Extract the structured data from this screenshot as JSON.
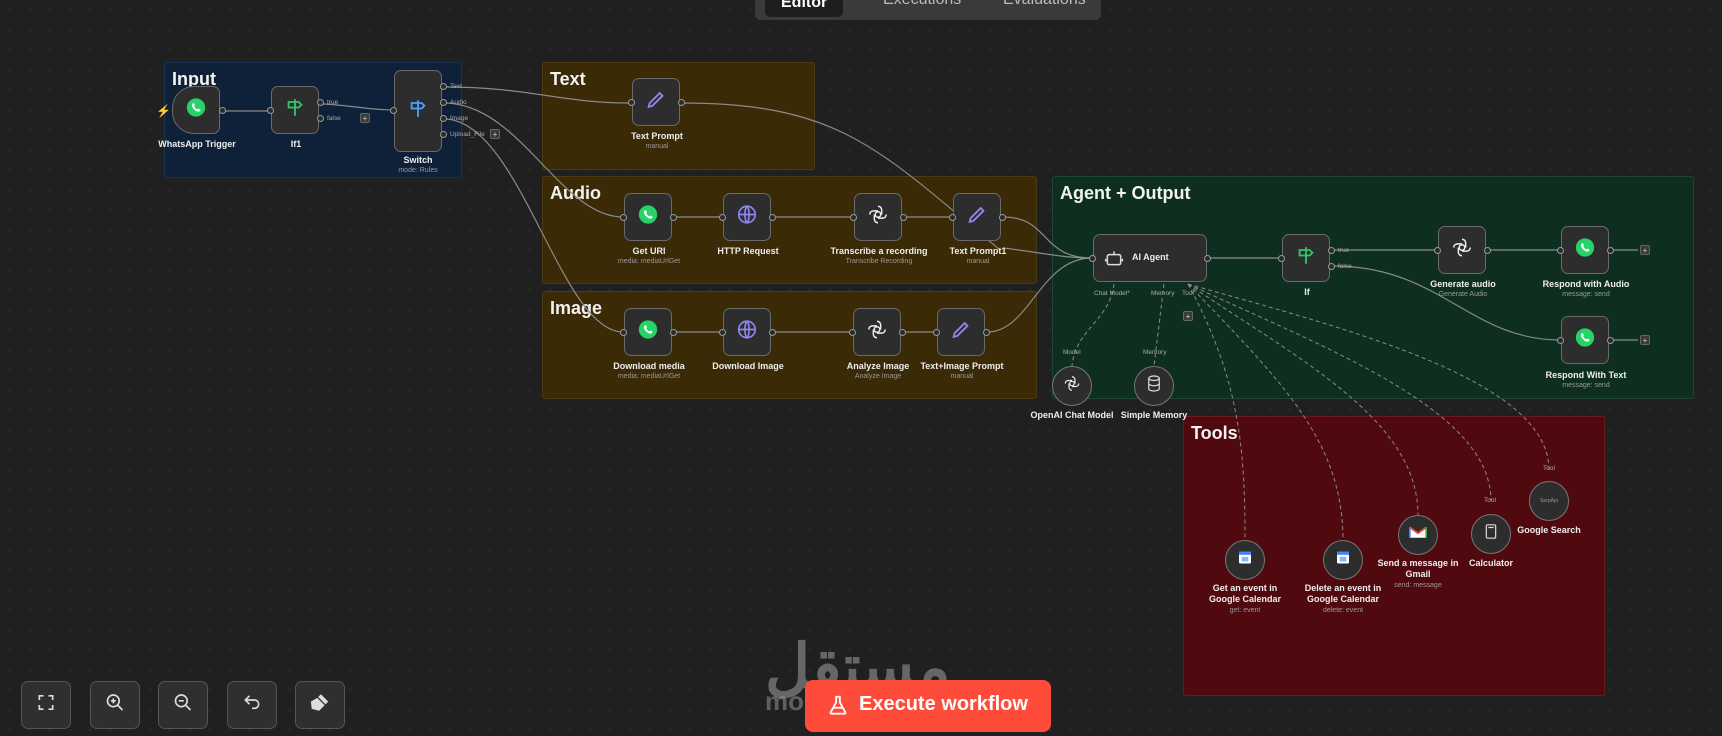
{
  "tabs": [
    "Editor",
    "Executions",
    "Evaluations"
  ],
  "sticky_notes": {
    "input": "Input",
    "text": "Text",
    "audio": "Audio",
    "image": "Image",
    "agent": "Agent + Output",
    "tools": "Tools"
  },
  "nodes": {
    "whatsapp_trigger": {
      "name": "WhatsApp Trigger"
    },
    "if1": {
      "name": "If1",
      "out_true": "true",
      "out_false": "false"
    },
    "switch": {
      "name": "Switch",
      "subtitle": "mode: Rules",
      "out_text": "Text",
      "out_audio": "Audio",
      "out_image": "Image",
      "out_upload": "Upload_File"
    },
    "text_prompt": {
      "name": "Text Prompt",
      "subtitle": "manual"
    },
    "get_url": {
      "name": "Get URl",
      "subtitle": "media: mediaUrlGet"
    },
    "http_request": {
      "name": "HTTP Request"
    },
    "transcribe": {
      "name": "Transcribe a recording",
      "subtitle": "Transcribe Recording"
    },
    "text_prompt1": {
      "name": "Text Prompt1",
      "subtitle": "manual"
    },
    "download_media": {
      "name": "Download media",
      "subtitle": "media: mediaUrlGet"
    },
    "download_image": {
      "name": "Download Image"
    },
    "analyze_image": {
      "name": "Analyze Image",
      "subtitle": "Analyze Image"
    },
    "text_image_prompt": {
      "name": "Text+Image Prompt",
      "subtitle": "manual"
    },
    "ai_agent": {
      "name": "AI Agent",
      "port_chat": "Chat Model*",
      "port_memory": "Memory",
      "port_tool": "Tool"
    },
    "if": {
      "name": "If",
      "out_true": "true",
      "out_false": "false"
    },
    "generate_audio": {
      "name": "Generate audio",
      "subtitle": "Generate Audio"
    },
    "respond_audio": {
      "name": "Respond with Audio",
      "subtitle": "message: send"
    },
    "respond_text": {
      "name": "Respond With Text",
      "subtitle": "message: send"
    },
    "openai_chat": {
      "name": "OpenAI Chat Model",
      "port": "Model"
    },
    "simple_memory": {
      "name": "Simple Memory",
      "port": "Memory"
    },
    "get_event": {
      "name_line1": "Get an event in",
      "name_line2": "Google Calendar",
      "subtitle": "get: event"
    },
    "delete_event": {
      "name_line1": "Delete an event in",
      "name_line2": "Google Calendar",
      "subtitle": "delete: event"
    },
    "gmail": {
      "name_line1": "Send a message in",
      "name_line2": "Gmail",
      "subtitle": "send: message"
    },
    "calculator": {
      "name": "Calculator",
      "port": "Tool"
    },
    "google_search": {
      "name": "Google Search",
      "port": "Tool",
      "inner": "SerpApi"
    }
  },
  "controls": {
    "execute": "Execute workflow",
    "icons": [
      "fullscreen-icon",
      "zoom-in-icon",
      "zoom-out-icon",
      "undo-icon",
      "clear-execution-icon"
    ]
  },
  "watermark": {
    "arabic": "مستقل",
    "latin": "mostaql.com"
  },
  "colors": {
    "canvas": "#202020",
    "input_note": "#0f2138",
    "text_note": "#3a2a06",
    "agent_note": "#0e2f1f",
    "tools_note": "#500a0f",
    "execute": "#ff4b3a",
    "whatsapp": "#25d366",
    "accent_purple": "#8f87f1"
  }
}
